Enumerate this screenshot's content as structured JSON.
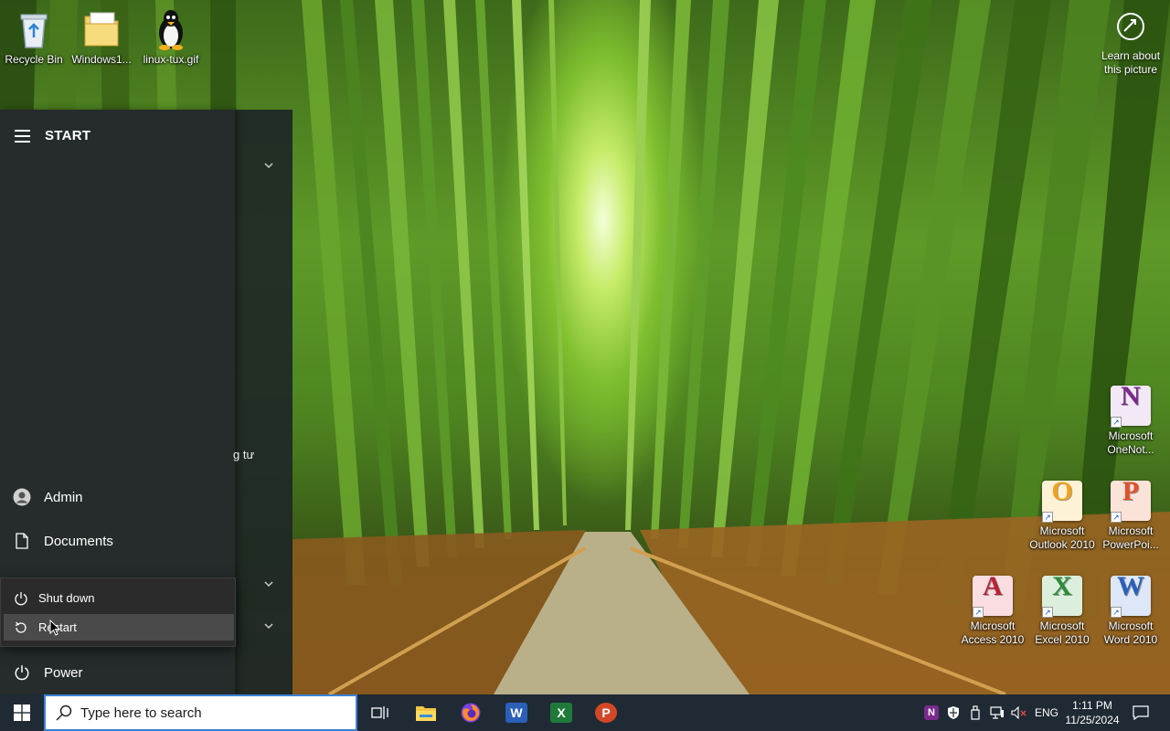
{
  "desktop": {
    "icons_left": [
      {
        "label": "Recycle Bin",
        "icon": "recycle-bin-icon"
      },
      {
        "label": "Windows1...",
        "icon": "folder-icon"
      },
      {
        "label": "linux-tux.gif",
        "icon": "tux-penguin-icon"
      }
    ],
    "learn_picture": {
      "line1": "Learn about",
      "line2": "this picture",
      "icon": "camera-circle-icon"
    },
    "office_icons": [
      {
        "line1": "Microsoft",
        "line2": "OneNot...",
        "letter": "N",
        "color": "#7b2a8c",
        "icon": "onenote-icon"
      },
      {
        "line1": "Microsoft",
        "line2": "Outlook 2010",
        "letter": "O",
        "color": "#f0a21a",
        "icon": "outlook-icon"
      },
      {
        "line1": "Microsoft",
        "line2": "PowerPoi...",
        "letter": "P",
        "color": "#e0522a",
        "icon": "powerpoint-icon"
      },
      {
        "line1": "Microsoft",
        "line2": "Access 2010",
        "letter": "A",
        "color": "#b52435",
        "icon": "access-icon"
      },
      {
        "line1": "Microsoft",
        "line2": "Excel 2010",
        "letter": "X",
        "color": "#2f8d3a",
        "icon": "excel-icon"
      },
      {
        "line1": "Microsoft",
        "line2": "Word 2010",
        "letter": "W",
        "color": "#2b5fb8",
        "icon": "word-icon"
      }
    ]
  },
  "start_menu": {
    "title": "START",
    "partial_text": "g tư",
    "admin_label": "Admin",
    "documents_label": "Documents",
    "power_label": "Power",
    "flyout": {
      "shutdown_label": "Shut down",
      "restart_label": "Restart"
    }
  },
  "taskbar": {
    "search_placeholder": "Type here to search",
    "pinned": [
      {
        "name": "task-view-icon"
      },
      {
        "name": "file-explorer-icon"
      },
      {
        "name": "firefox-icon"
      },
      {
        "name": "word-icon",
        "letter": "W",
        "color": "#2b5fb8"
      },
      {
        "name": "excel-icon",
        "letter": "X",
        "color": "#1f7a3a"
      },
      {
        "name": "powerpoint-icon",
        "letter": "P",
        "color": "#d24726"
      }
    ],
    "tray": {
      "language": "ENG",
      "time": "1:11 PM",
      "date": "11/25/2024",
      "onenote_letter": "N"
    }
  }
}
